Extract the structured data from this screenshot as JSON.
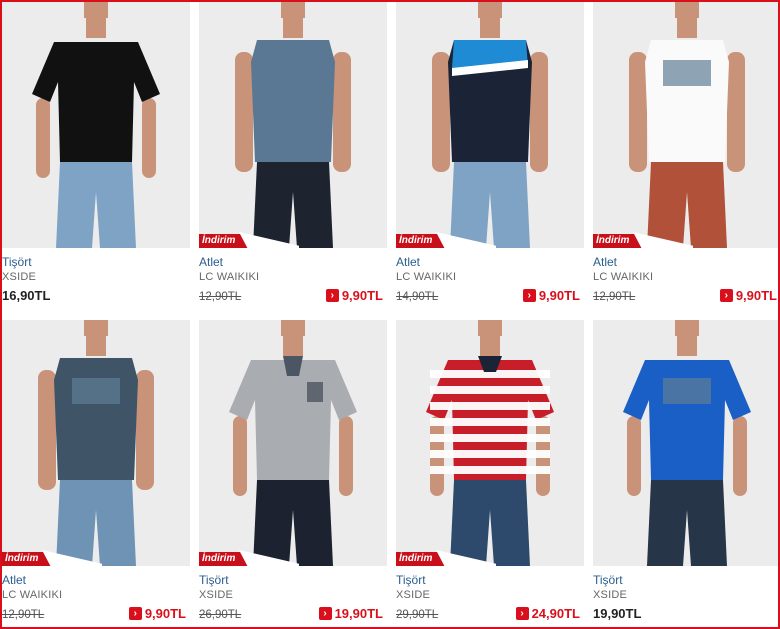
{
  "products": [
    {
      "category": "Tişört",
      "brand": "XSIDE",
      "old_price": "",
      "price": "16,90TL",
      "discount": false,
      "badge": "",
      "shirt": "#111111",
      "sleeve": "short",
      "pants": "#7fa3c4",
      "design": "plain"
    },
    {
      "category": "Atlet",
      "brand": "LC WAIKIKI",
      "old_price": "12,90TL",
      "price": "9,90TL",
      "discount": true,
      "badge": "İndirim",
      "shirt": "#5a7894",
      "sleeve": "none",
      "pants": "#1d2430",
      "design": "plain"
    },
    {
      "category": "Atlet",
      "brand": "LC WAIKIKI",
      "old_price": "14,90TL",
      "price": "9,90TL",
      "discount": true,
      "badge": "İndirim",
      "shirt": "#1b2436",
      "sleeve": "none",
      "pants": "#7fa3c4",
      "design": "blueband"
    },
    {
      "category": "Atlet",
      "brand": "LC WAIKIKI",
      "old_price": "12,90TL",
      "price": "9,90TL",
      "discount": true,
      "badge": "İndirim",
      "shirt": "#fafafa",
      "sleeve": "none",
      "pants": "#b1513a",
      "design": "print"
    },
    {
      "category": "Atlet",
      "brand": "LC WAIKIKI",
      "old_price": "12,90TL",
      "price": "9,90TL",
      "discount": true,
      "badge": "İndirim",
      "shirt": "#3f5466",
      "sleeve": "none",
      "pants": "#6f93b5",
      "design": "print"
    },
    {
      "category": "Tişört",
      "brand": "XSIDE",
      "old_price": "26,90TL",
      "price": "19,90TL",
      "discount": true,
      "badge": "İndirim",
      "shirt": "#a9adb2",
      "sleeve": "short",
      "pants": "#1c2230",
      "design": "polo"
    },
    {
      "category": "Tişört",
      "brand": "XSIDE",
      "old_price": "29,90TL",
      "price": "24,90TL",
      "discount": true,
      "badge": "İndirim",
      "shirt": "#c81e2a",
      "sleeve": "short",
      "pants": "#2d4a6c",
      "design": "stripes"
    },
    {
      "category": "Tişört",
      "brand": "XSIDE",
      "old_price": "",
      "price": "19,90TL",
      "discount": false,
      "badge": "",
      "shirt": "#1a5fc6",
      "sleeve": "short",
      "pants": "#263548",
      "design": "print"
    }
  ]
}
